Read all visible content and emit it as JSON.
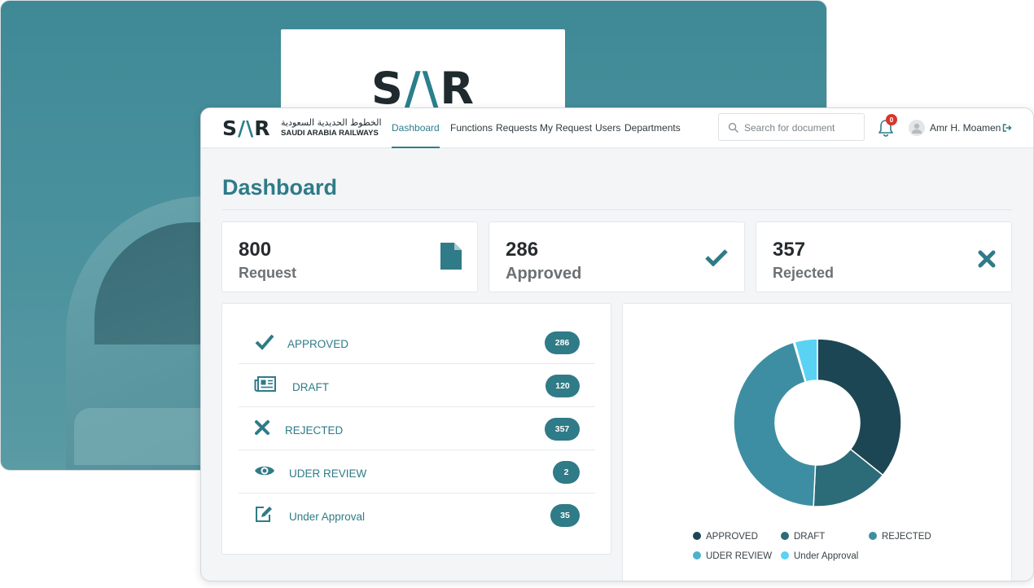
{
  "background": {
    "logo": {
      "left": "S",
      "mid": "/\\",
      "right": "R"
    }
  },
  "brand": {
    "logo": {
      "left": "S",
      "mid": "/\\",
      "right": "R"
    },
    "arabic_name": "الخطوط الحديدية السعودية",
    "english_name": "SAUDI ARABIA RAILWAYS"
  },
  "nav": {
    "items": [
      {
        "label": "Dashboard",
        "active": true
      },
      {
        "label": "Functions"
      },
      {
        "label": "Requests"
      },
      {
        "label": "My Request"
      },
      {
        "label": "Users"
      },
      {
        "label": "Departments"
      }
    ]
  },
  "search": {
    "placeholder": "Search for document",
    "value": ""
  },
  "notifications": {
    "count": "0"
  },
  "user": {
    "name": "Amr H. Moamen"
  },
  "page": {
    "title": "Dashboard"
  },
  "stats": [
    {
      "value": "800",
      "label": "Request",
      "icon": "document-icon"
    },
    {
      "value": "286",
      "label": "Approved",
      "icon": "check-icon"
    },
    {
      "value": "357",
      "label": "Rejected",
      "icon": "x-icon"
    }
  ],
  "status_list": [
    {
      "label": "APPROVED",
      "count": "286",
      "icon": "check-icon"
    },
    {
      "label": "DRAFT",
      "count": "120",
      "icon": "newspaper-icon"
    },
    {
      "label": "REJECTED",
      "count": "357",
      "icon": "x-icon"
    },
    {
      "label": "UDER REVIEW",
      "count": "2",
      "icon": "eye-icon"
    },
    {
      "label": "Under Approval",
      "count": "35",
      "icon": "edit-icon"
    }
  ],
  "colors": {
    "accent": "#2f7b88",
    "approved": "#1d4654",
    "draft": "#2c6b78",
    "rejected": "#3e8ea3",
    "under_review": "#4fb0cc",
    "under_approval": "#5ad2f4"
  },
  "chart_data": {
    "type": "pie",
    "donut": true,
    "categories": [
      "APPROVED",
      "DRAFT",
      "REJECTED",
      "UDER REVIEW",
      "Under Approval"
    ],
    "values": [
      286,
      120,
      357,
      2,
      35
    ],
    "colors": [
      "#1d4654",
      "#2c6b78",
      "#3e8ea3",
      "#4fb0cc",
      "#5ad2f4"
    ],
    "legend": "bottom"
  }
}
